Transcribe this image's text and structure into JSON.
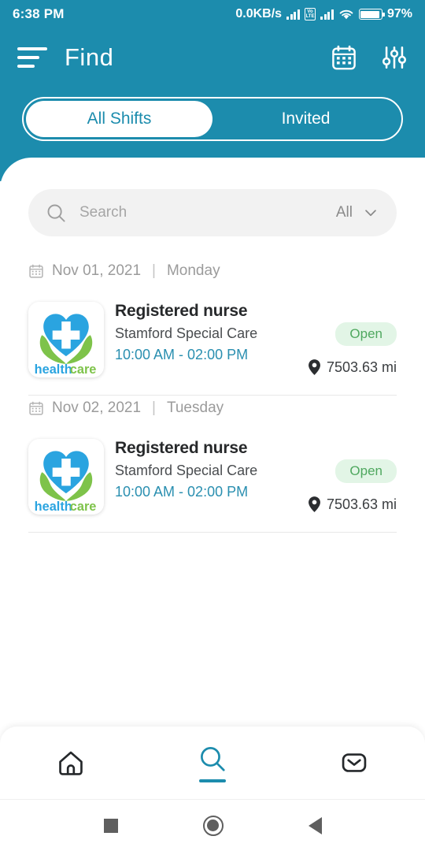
{
  "statusbar": {
    "time": "6:38 PM",
    "network_speed": "0.0KB/s",
    "volte_top": "Vo",
    "volte_bottom": "LTE",
    "battery_percent": "97%",
    "wifi_icon": "wifi-icon",
    "battery_icon": "battery-icon",
    "signal_icon": "signal-bars-icon"
  },
  "appbar": {
    "title": "Find",
    "menu_icon": "hamburger-menu-icon",
    "calendar_icon": "calendar-icon",
    "filter_icon": "filter-sliders-icon"
  },
  "tabs": [
    {
      "label": "All Shifts",
      "active": true
    },
    {
      "label": "Invited",
      "active": false
    }
  ],
  "search": {
    "placeholder": "Search",
    "value": "",
    "filter_label": "All",
    "search_icon": "search-icon",
    "chevron_icon": "chevron-down-icon"
  },
  "groups": [
    {
      "date": "Nov 01, 2021",
      "separator": "|",
      "weekday": "Monday",
      "calendar_icon": "calendar-small-icon",
      "shifts": [
        {
          "title": "Registered nurse",
          "organization": "Stamford Special Care",
          "time": "10:00 AM - 02:00 PM",
          "status": "Open",
          "distance": "7503.63 mi",
          "logo_text_primary": "health",
          "logo_text_secondary": "care",
          "logo_name": "healthcare-logo",
          "pin_icon": "map-pin-icon"
        }
      ]
    },
    {
      "date": "Nov 02, 2021",
      "separator": "|",
      "weekday": "Tuesday",
      "calendar_icon": "calendar-small-icon",
      "shifts": [
        {
          "title": "Registered nurse",
          "organization": "Stamford Special Care",
          "time": "10:00 AM - 02:00 PM",
          "status": "Open",
          "distance": "7503.63 mi",
          "logo_text_primary": "health",
          "logo_text_secondary": "care",
          "logo_name": "healthcare-logo",
          "pin_icon": "map-pin-icon"
        }
      ]
    }
  ],
  "bottom_nav": [
    {
      "name": "home",
      "icon": "home-icon",
      "active": false
    },
    {
      "name": "search",
      "icon": "search-icon",
      "active": true
    },
    {
      "name": "messages",
      "icon": "envelope-icon",
      "active": false
    }
  ],
  "system_nav": [
    {
      "name": "recents",
      "icon": "square-icon"
    },
    {
      "name": "home",
      "icon": "circle-icon"
    },
    {
      "name": "back",
      "icon": "triangle-back-icon"
    }
  ],
  "colors": {
    "brand_teal": "#1c8cad",
    "status_open_bg": "#e2f5e6",
    "status_open_text": "#4fa85f",
    "logo_blue": "#2aa4e0",
    "logo_green": "#7ec34a"
  }
}
